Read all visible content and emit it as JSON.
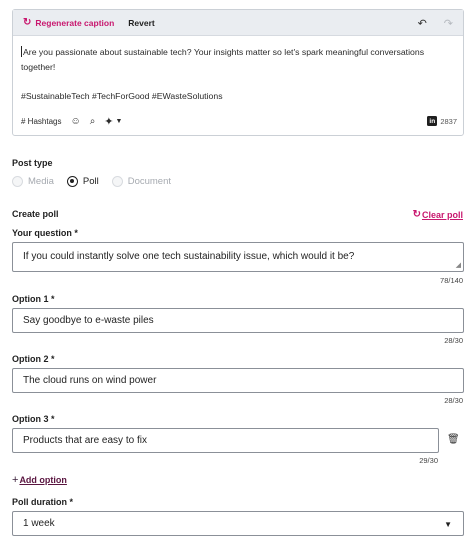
{
  "editor": {
    "regenerate_label": "Regenerate caption",
    "revert_label": "Revert",
    "caption_line1": "Are you passionate about sustainable tech? Your insights matter so let's spark meaningful conversations",
    "caption_line2": "together!",
    "hashtags_text": "#SustainableTech #TechForGood #EWasteSolutions",
    "hashtags_label": "# Hashtags",
    "char_count": "2837",
    "network_logo": "in"
  },
  "post_type": {
    "label": "Post type",
    "options": [
      "Media",
      "Poll",
      "Document"
    ],
    "selected": "Poll"
  },
  "poll": {
    "section_label": "Create poll",
    "clear_label": "Clear poll",
    "question_label": "Your question *",
    "question_value": "If you could instantly solve one tech sustainability issue, which would it be?",
    "question_counter": "78/140",
    "option1_label": "Option 1 *",
    "option1_value": "Say goodbye to e-waste piles",
    "option1_counter": "28/30",
    "option2_label": "Option 2 *",
    "option2_value": "The cloud runs on wind power",
    "option2_counter": "28/30",
    "option3_label": "Option 3 *",
    "option3_value": "Products that are easy to fix",
    "option3_counter": "29/30",
    "add_option_label": "Add option",
    "duration_label": "Poll duration *",
    "duration_value": "1 week"
  },
  "colors": {
    "accent": "#c8176e",
    "toolbar_bg": "#eaedf1",
    "border": "#8b9098"
  },
  "icons": [
    "regenerate-icon",
    "undo-icon",
    "redo-icon",
    "emoji-icon",
    "attachment-icon",
    "sparkle-icon",
    "chevron-down-icon",
    "linkedin-icon",
    "refresh-icon",
    "resize-grip-icon",
    "trash-icon",
    "plus-icon"
  ]
}
